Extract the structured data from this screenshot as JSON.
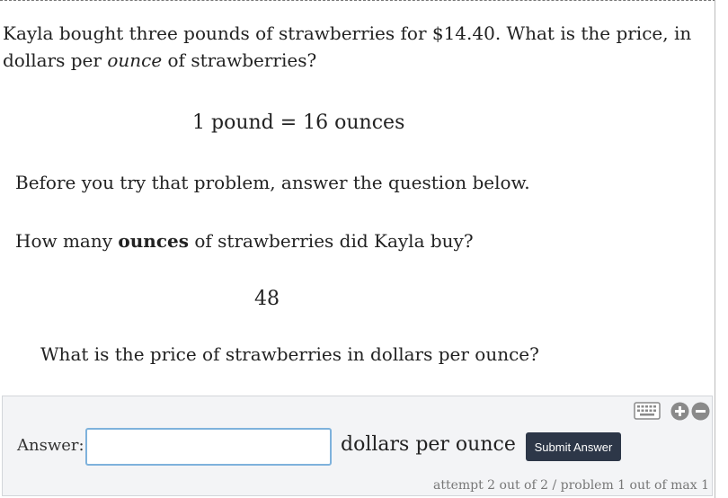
{
  "problem": {
    "text_part1": "Kayla bought three pounds of strawberries for $14.40. What is the price, in dollars per ",
    "text_emphasis": "ounce",
    "text_part2": " of strawberries?",
    "equation": "1 pound = 16 ounces"
  },
  "scaffold": {
    "instruction": "Before you try that problem, answer the question below.",
    "question_part1": "How many ",
    "question_bold": "ounces",
    "question_part2": " of strawberries did Kayla buy?",
    "answer": "48"
  },
  "current_question": "What is the price of strawberries in dollars per ounce?",
  "answer_panel": {
    "label": "Answer:",
    "input_value": "",
    "unit": "dollars per ounce",
    "submit_label": "Submit Answer",
    "attempt_info": "attempt 2 out of 2 / problem 1 out of max 1",
    "icons": [
      "keyboard-icon",
      "zoom-in-icon",
      "zoom-out-icon"
    ]
  },
  "colors": {
    "submit_bg": "#2d3748",
    "input_border": "#7eb2dc",
    "panel_bg": "#f3f4f6",
    "icon_gray": "#8a8a8a"
  }
}
